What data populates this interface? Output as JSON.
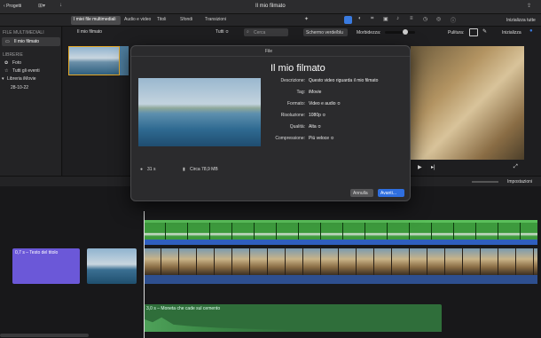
{
  "titlebar": {
    "back_label": "Progetti",
    "title": "Il mio filmato"
  },
  "toolbar": {
    "tabs": [
      "I miei file multimediali",
      "Audio e video",
      "Titoli",
      "Sfondi",
      "Transizioni"
    ],
    "reset_all": "Inizializza tutte"
  },
  "sidebar": {
    "section1": "FILE MULTIMEDIALI",
    "project_item": "Il mio filmato",
    "section2": "LIBRERIE",
    "items": [
      "Foto",
      "Tutti gli eventi",
      "Libreria iMovie",
      "28-10-22"
    ]
  },
  "browser": {
    "title": "Il mio filmato",
    "filter": "Tutti",
    "search_placeholder": "Cerca"
  },
  "viewer": {
    "effect_select": "Schermo verde/blu",
    "softness_label": "Morbidezza:",
    "cleanup_label": "Pulitura:",
    "reset_label": "Inizializza"
  },
  "timeline_bar": {
    "settings_label": "Impostazioni"
  },
  "timeline": {
    "title_clip_label": "0,7 s – Testo del titolo",
    "audio_clip_label": "3,0 s – Moneta che cade sul cemento"
  },
  "dialog": {
    "window_title": "File",
    "heading": "Il mio filmato",
    "fields": [
      {
        "label": "Descrizione:",
        "value": "Questo video riguarda il mio filmato"
      },
      {
        "label": "Tag:",
        "value": "iMovie"
      },
      {
        "label": "Formato:",
        "value": "Video e audio ≎"
      },
      {
        "label": "Risoluzione:",
        "value": "1080p ≎"
      },
      {
        "label": "Qualità:",
        "value": "Alta ≎"
      },
      {
        "label": "Compressione:",
        "value": "Più veloce ≎"
      }
    ],
    "duration": "31 s",
    "size": "Circa 78,9 MB",
    "cancel": "Annulla",
    "next": "Avanti..."
  },
  "colors": {
    "accent": "#2f6fe0",
    "green_clip": "#3d9a3d",
    "purple_clip": "#6b58d8",
    "audio_green": "#2f6e3a"
  }
}
